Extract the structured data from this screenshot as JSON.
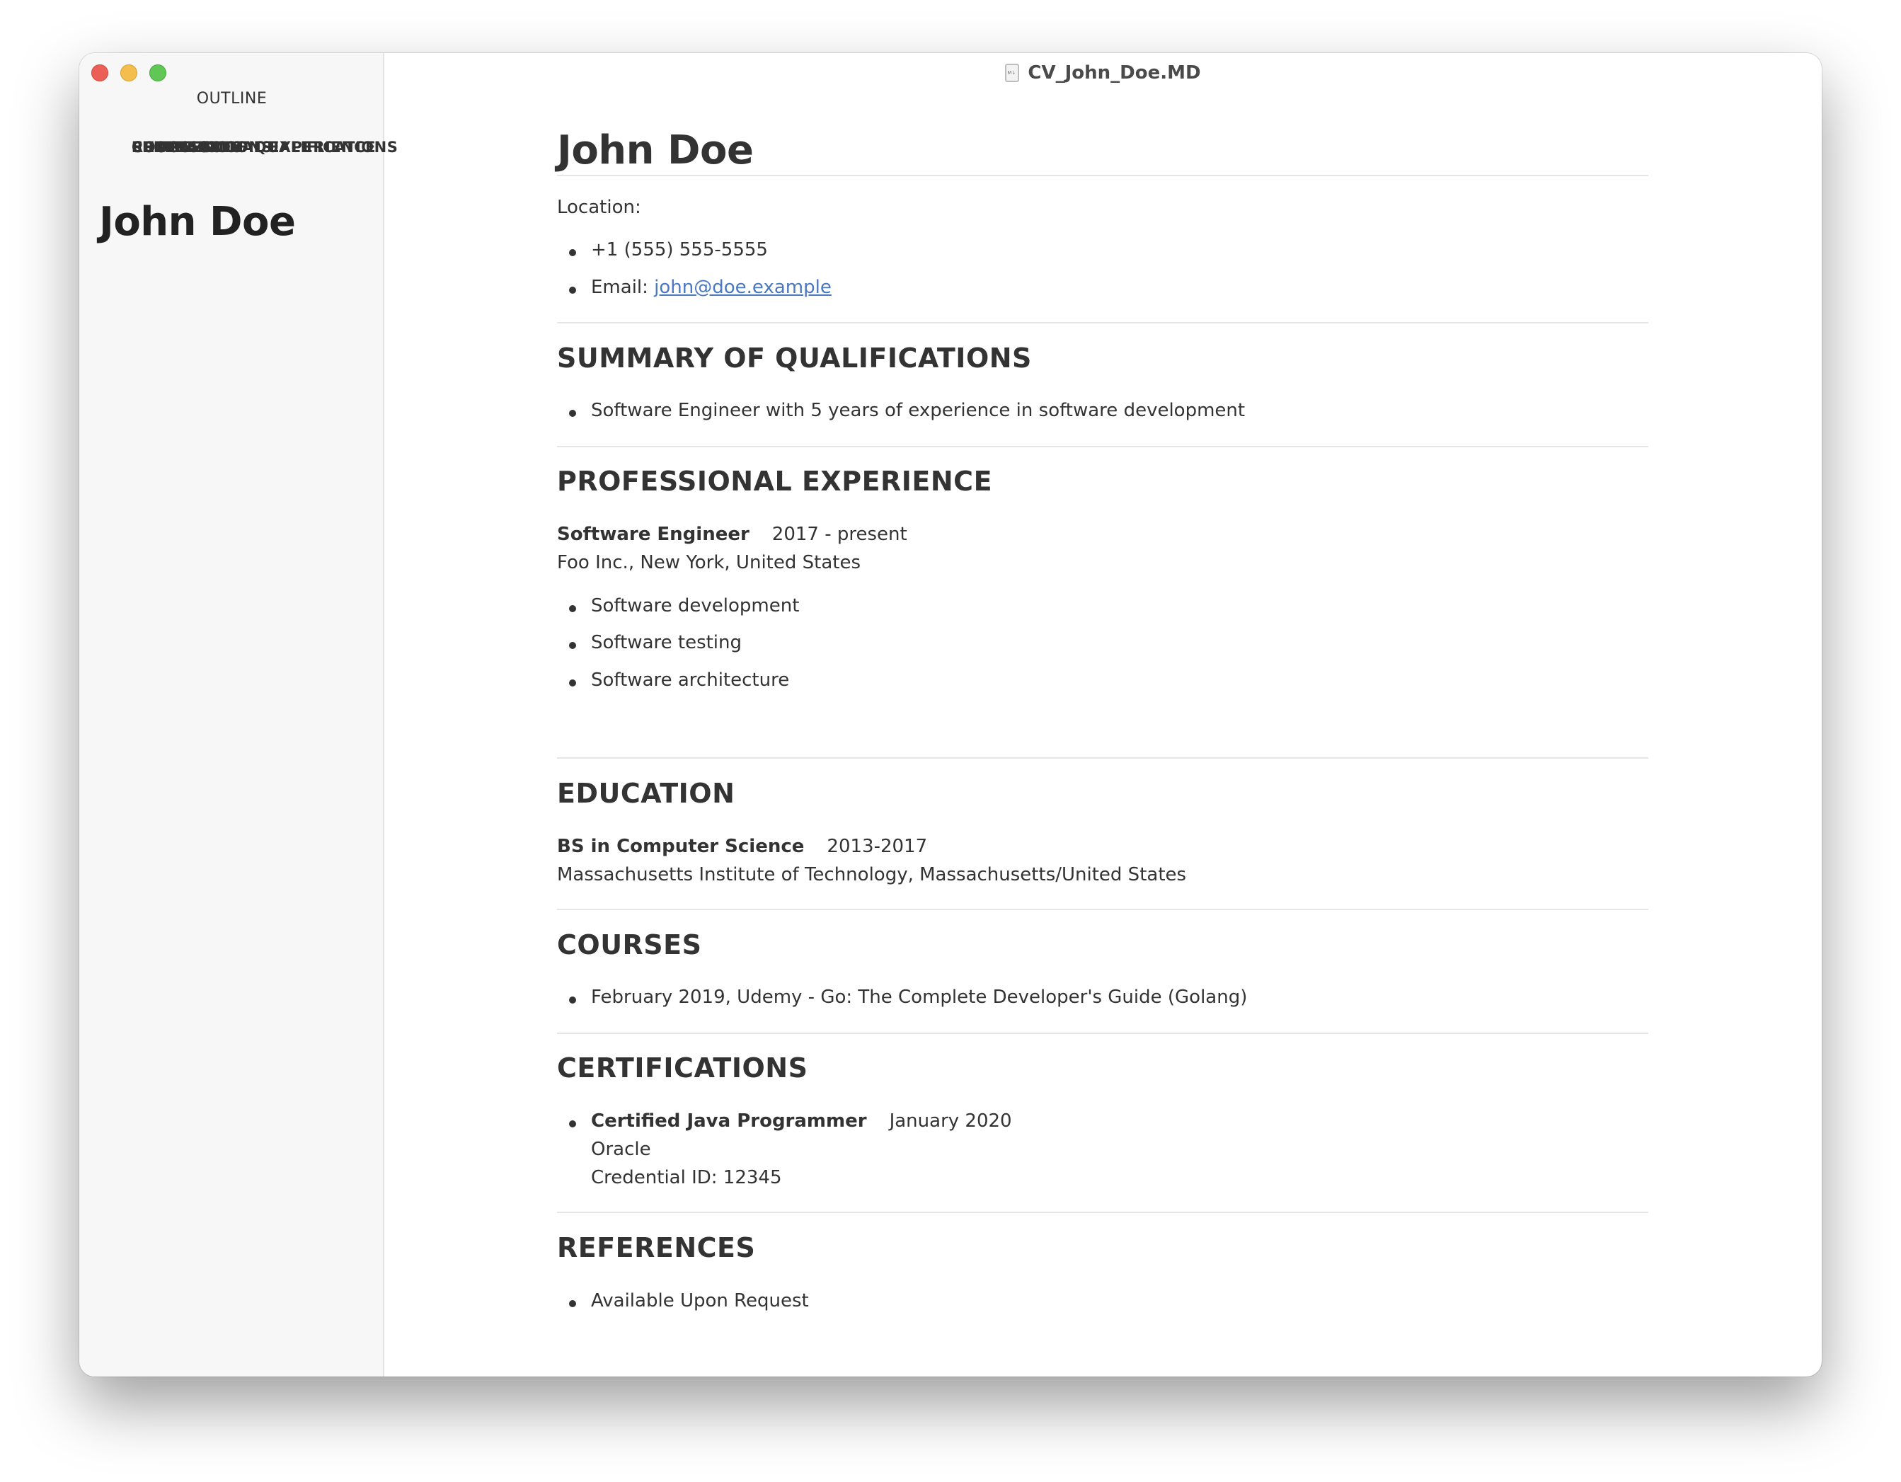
{
  "window": {
    "title": "CV_John_Doe.MD",
    "file_icon": "markdown-file-icon"
  },
  "sidebar": {
    "title": "OUTLINE",
    "items": [
      {
        "label": "John Doe",
        "level": 1
      },
      {
        "label": "SUMMARY OF QUALIFICATIONS",
        "level": 2
      },
      {
        "label": "PROFESSIONAL EXPERIENCE",
        "level": 2
      },
      {
        "label": "EDUCATION",
        "level": 2
      },
      {
        "label": "COURSES",
        "level": 2
      },
      {
        "label": "CERTIFICATIONS",
        "level": 2
      },
      {
        "label": "REFERENCES",
        "level": 2
      }
    ]
  },
  "doc": {
    "name": "John Doe",
    "location_label": "Location:",
    "contacts": {
      "phone": "+1 (555) 555-5555",
      "email_label": "Email:",
      "email": "john@doe.example"
    },
    "summary": {
      "heading": "SUMMARY OF QUALIFICATIONS",
      "items": [
        "Software Engineer with 5 years of experience in software development"
      ]
    },
    "experience": {
      "heading": "PROFESSIONAL EXPERIENCE",
      "role": "Software Engineer",
      "period": "2017 - present",
      "company": "Foo Inc., New York, United States",
      "items": [
        "Software development",
        "Software testing",
        "Software architecture"
      ]
    },
    "education": {
      "heading": "EDUCATION",
      "degree": "BS in Computer Science",
      "period": "2013-2017",
      "school": "Massachusetts Institute of Technology, Massachusetts/United States"
    },
    "courses": {
      "heading": "COURSES",
      "items": [
        "February 2019, Udemy - Go: The Complete Developer's Guide (Golang)"
      ]
    },
    "certifications": {
      "heading": "CERTIFICATIONS",
      "name": "Certified Java Programmer",
      "date": "January 2020",
      "issuer": "Oracle",
      "credential": "Credential ID: 12345"
    },
    "references": {
      "heading": "REFERENCES",
      "items": [
        "Available Upon Request"
      ]
    }
  }
}
